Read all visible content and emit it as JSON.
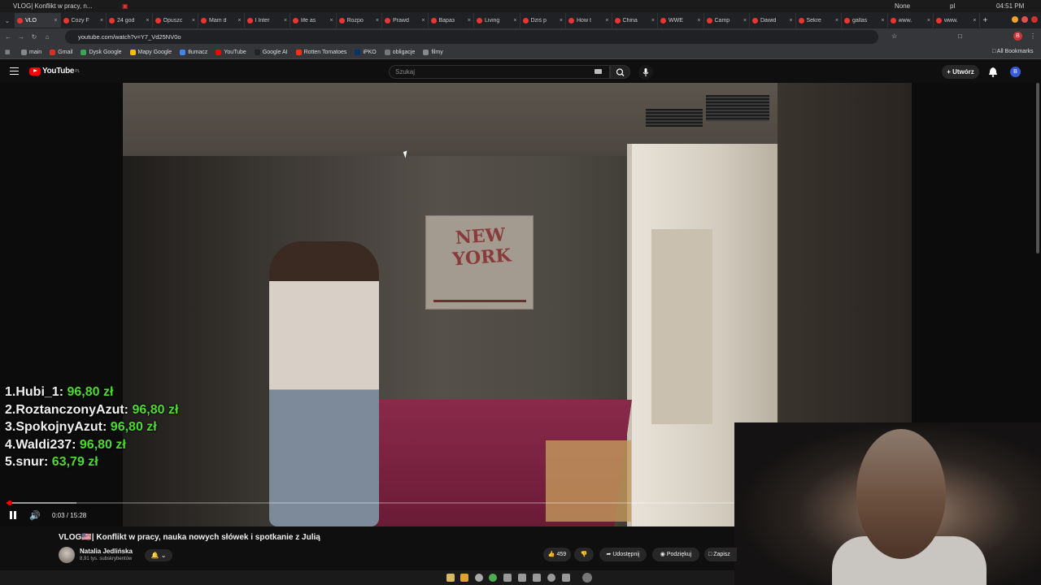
{
  "os_bar": {
    "window_title": "VLOG| Konflikt w pracy, n...",
    "status_none": "None",
    "lang": "pl",
    "clock": "04:51 PM"
  },
  "tabs": [
    {
      "label": "VLO",
      "active": true
    },
    {
      "label": "Cozy F"
    },
    {
      "label": "24 god"
    },
    {
      "label": "Opuszc"
    },
    {
      "label": "Mam d"
    },
    {
      "label": "I Inter"
    },
    {
      "label": "life as"
    },
    {
      "label": "Rozpo"
    },
    {
      "label": "Prawd"
    },
    {
      "label": "Вараз"
    },
    {
      "label": "Living"
    },
    {
      "label": "Dziś p"
    },
    {
      "label": "How t"
    },
    {
      "label": "China"
    },
    {
      "label": "WWE"
    },
    {
      "label": "Camp"
    },
    {
      "label": "Dawid"
    },
    {
      "label": "Sekre"
    },
    {
      "label": "gallas"
    },
    {
      "label": "www."
    },
    {
      "label": "www."
    }
  ],
  "address_bar": {
    "url": "youtube.com/watch?v=Y7_Vd25NV0o"
  },
  "bookmarks": [
    {
      "label": "main",
      "color": "#888888"
    },
    {
      "label": "Gmail",
      "color": "#d93025"
    },
    {
      "label": "Dysk Google",
      "color": "#34a853"
    },
    {
      "label": "Mapy Google",
      "color": "#fbbc04"
    },
    {
      "label": "tłumacz",
      "color": "#4285f4"
    },
    {
      "label": "YouTube",
      "color": "#ff0000"
    },
    {
      "label": "Google AI",
      "color": "#222222"
    },
    {
      "label": "Rotten Tomatoes",
      "color": "#fa320a"
    },
    {
      "label": "iPKO",
      "color": "#003574"
    },
    {
      "label": "obligacje",
      "color": "#777777"
    },
    {
      "label": "filmy",
      "color": "#888888"
    }
  ],
  "bookmarks_all": "All Bookmarks",
  "youtube": {
    "logo_text": "YouTube",
    "logo_region": "PL",
    "search_placeholder": "Szukaj",
    "create_label": "Utwórz",
    "avatar_letter": "B"
  },
  "overlay": {
    "donations": [
      {
        "rank": "1.",
        "name": "Hubi_1:",
        "amount": "96,80 zł"
      },
      {
        "rank": "2.",
        "name": "RoztanczonyAzut:",
        "amount": "96,80 zł"
      },
      {
        "rank": "3.",
        "name": "SpokojnyAzut:",
        "amount": "96,80 zł"
      },
      {
        "rank": "4.",
        "name": "Waldi237:",
        "amount": "96,80 zł"
      },
      {
        "rank": "5.",
        "name": "snur:",
        "amount": "63,79 zł"
      }
    ],
    "poster_text": "NEW YORK"
  },
  "player": {
    "time": "0:03 / 15:28",
    "progress_fraction": 0.003
  },
  "video_info": {
    "title": "VLOG🇺🇸| Konflikt w pracy, nauka nowych słówek i spotkanie z Julią",
    "channel": "Natalia Jedlińska",
    "subscribers": "8,91 tys. subskrybentów",
    "likes": "459",
    "share": "Udostępnij",
    "thanks": "Podziękuj",
    "save": "Zapisz"
  }
}
